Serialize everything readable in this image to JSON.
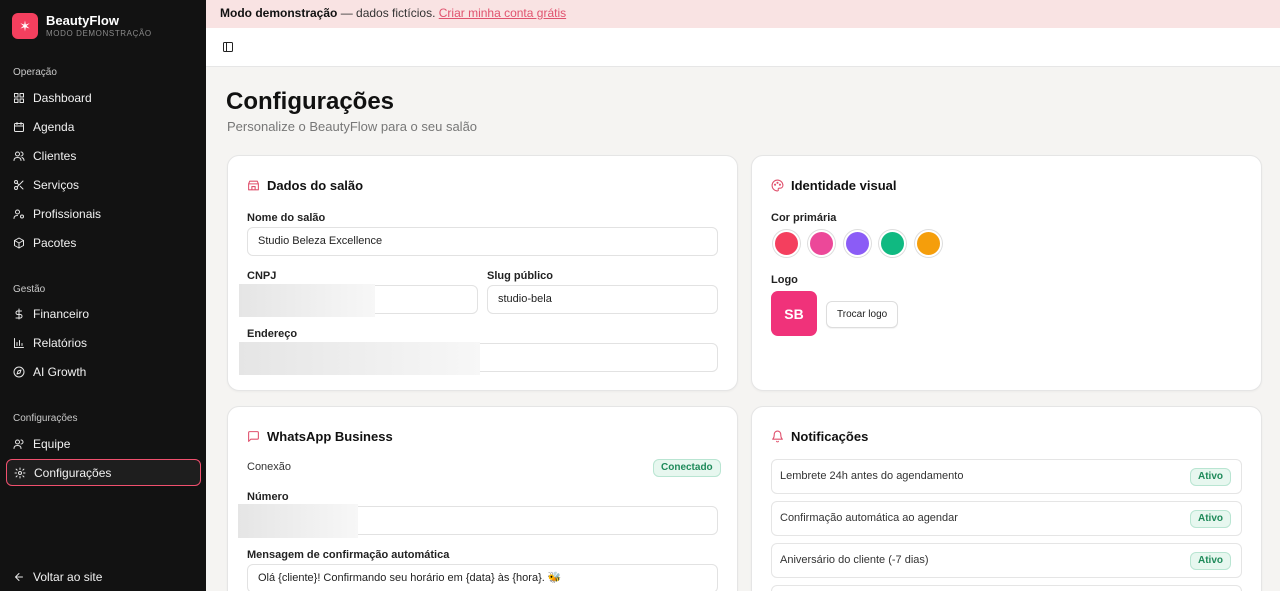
{
  "app": {
    "name": "BeautyFlow",
    "mode": "MODO DEMONSTRAÇÃO"
  },
  "sidebar": {
    "sections": [
      {
        "label": "Operação"
      },
      {
        "label": "Gestão"
      },
      {
        "label": "Configurações"
      }
    ],
    "items": [
      {
        "label": "Dashboard"
      },
      {
        "label": "Agenda"
      },
      {
        "label": "Clientes"
      },
      {
        "label": "Serviços"
      },
      {
        "label": "Profissionais"
      },
      {
        "label": "Pacotes"
      },
      {
        "label": "Financeiro"
      },
      {
        "label": "Relatórios"
      },
      {
        "label": "AI Growth"
      },
      {
        "label": "Equipe"
      },
      {
        "label": "Configurações"
      }
    ],
    "back": "Voltar ao site"
  },
  "banner": {
    "bold": "Modo demonstração",
    "text": " — dados fictícios. ",
    "link": "Criar minha conta grátis"
  },
  "page": {
    "title": "Configurações",
    "subtitle": "Personalize o BeautyFlow para o seu salão"
  },
  "salon": {
    "title": "Dados do salão",
    "name_label": "Nome do salão",
    "name_value": "Studio Beleza Excellence",
    "cnpj_label": "CNPJ",
    "slug_label": "Slug público",
    "slug_value": "studio-bela",
    "address_label": "Endereço"
  },
  "visual": {
    "title": "Identidade visual",
    "color_label": "Cor primária",
    "colors": [
      "#f43f5e",
      "#ec4899",
      "#8b5cf6",
      "#10b981",
      "#f59e0b"
    ],
    "logo_label": "Logo",
    "logo_initials": "SB",
    "change_logo": "Trocar logo"
  },
  "whatsapp": {
    "title": "WhatsApp Business",
    "connection_label": "Conexão",
    "status": "Conectado",
    "number_label": "Número",
    "message_label": "Mensagem de confirmação automática",
    "message_value": "Olá {cliente}! Confirmando seu horário em {data} às {hora}. 🐝"
  },
  "notifications": {
    "title": "Notificações",
    "items": [
      {
        "label": "Lembrete 24h antes do agendamento",
        "status": "Ativo"
      },
      {
        "label": "Confirmação automática ao agendar",
        "status": "Ativo"
      },
      {
        "label": "Aniversário do cliente (-7 dias)",
        "status": "Ativo"
      }
    ]
  }
}
